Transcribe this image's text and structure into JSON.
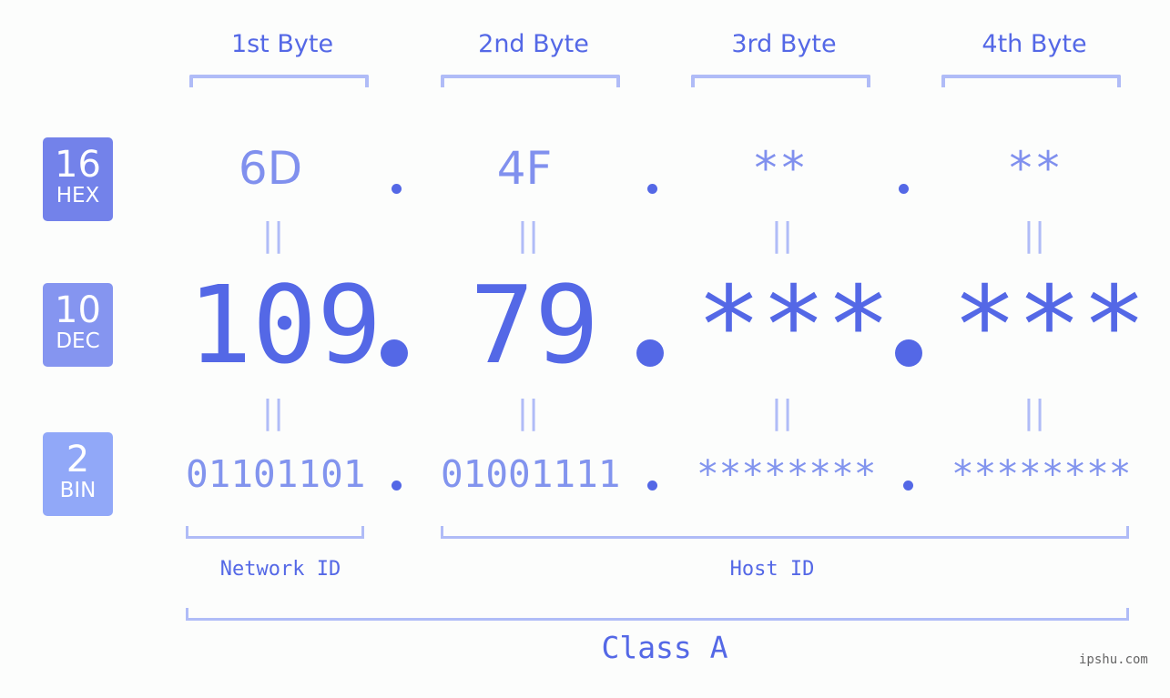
{
  "headers": [
    "1st Byte",
    "2nd Byte",
    "3rd Byte",
    "4th Byte"
  ],
  "rows": {
    "hex": {
      "base": "16",
      "label": "HEX",
      "values": [
        "6D",
        "4F",
        "**",
        "**"
      ]
    },
    "dec": {
      "base": "10",
      "label": "DEC",
      "values": [
        "109",
        "79",
        "***",
        "***"
      ]
    },
    "bin": {
      "base": "2",
      "label": "BIN",
      "values": [
        "01101101",
        "01001111",
        "********",
        "********"
      ]
    }
  },
  "equals_symbol": "||",
  "network_label": "Network ID",
  "host_label": "Host ID",
  "class_label": "Class A",
  "watermark": "ipshu.com",
  "colors": {
    "accent": "#5468e6",
    "hex_badge": "#7382ea",
    "dec_badge": "#8595f0",
    "bin_badge": "#91a8f8",
    "bracket": "#b0bcf7",
    "hex_text": "#8090ee",
    "bin_text": "#8294ee"
  }
}
